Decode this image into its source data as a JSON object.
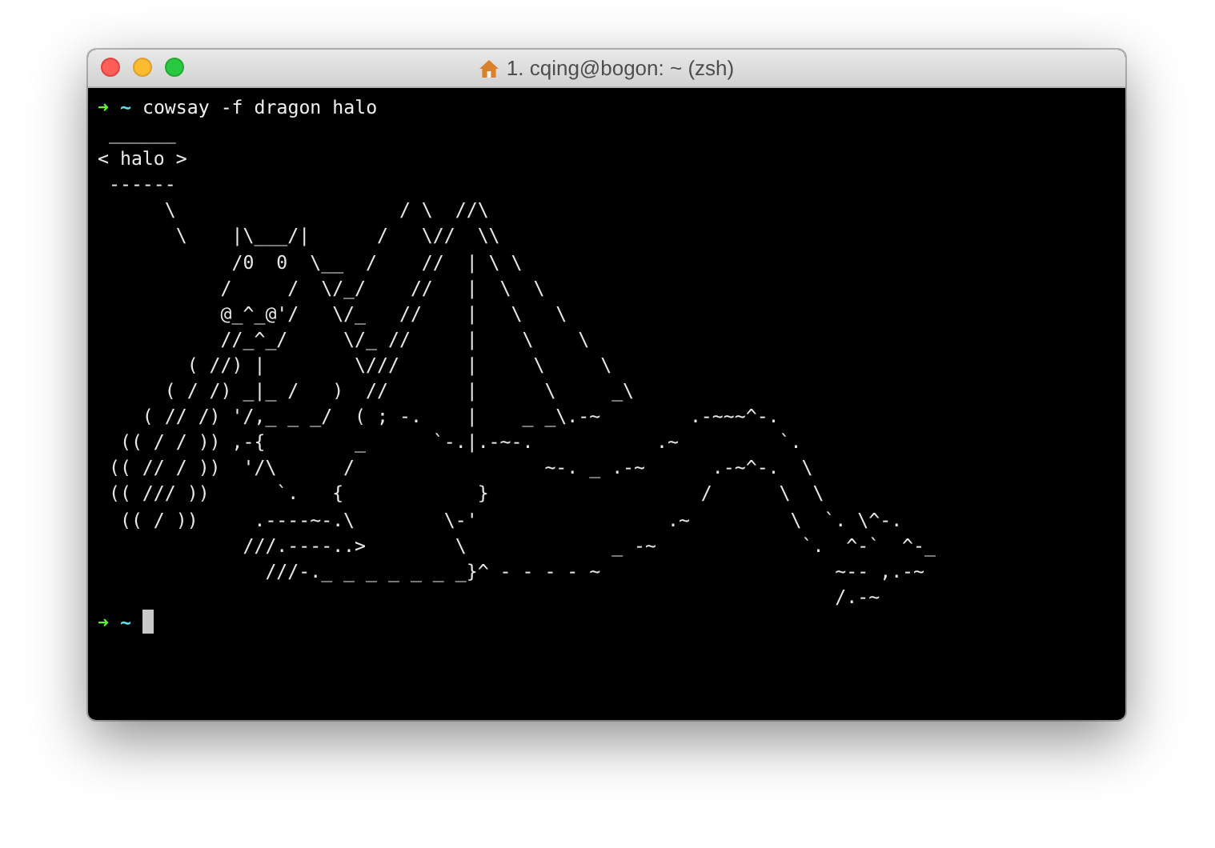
{
  "window": {
    "title": "1. cqing@bogon: ~ (zsh)"
  },
  "command_prompt": {
    "arrow": "➜",
    "cwd": "~",
    "command": "cowsay -f dragon halo"
  },
  "output_lines": [
    " ______",
    "< halo >",
    " ------",
    "      \\                    / \\  //\\",
    "       \\    |\\___/|      /   \\//  \\\\",
    "            /0  0  \\__  /    //  | \\ \\",
    "           /     /  \\/_/    //   |  \\  \\",
    "           @_^_@'/   \\/_   //    |   \\   \\",
    "           //_^_/     \\/_ //     |    \\    \\",
    "        ( //) |        \\///      |     \\     \\",
    "      ( / /) _|_ /   )  //       |      \\     _\\",
    "    ( // /) '/,_ _ _/  ( ; -.    |    _ _\\.-~        .-~~~^-.",
    "  (( / / )) ,-{        _      `-.|.-~-.           .~         `.",
    " (( // / ))  '/\\      /                 ~-. _ .-~      .-~^-.  \\",
    " (( /// ))      `.   {            }                   /      \\  \\",
    "  (( / ))     .----~-.\\        \\-'                 .~         \\  `. \\^-.",
    "             ///.----..>        \\             _ -~             `.  ^-`  ^-_",
    "               ///-._ _ _ _ _ _ _}^ - - - - ~                     ~-- ,.-~",
    "                                                                  /.-~"
  ],
  "input_prompt": {
    "arrow": "➜",
    "cwd": "~"
  }
}
